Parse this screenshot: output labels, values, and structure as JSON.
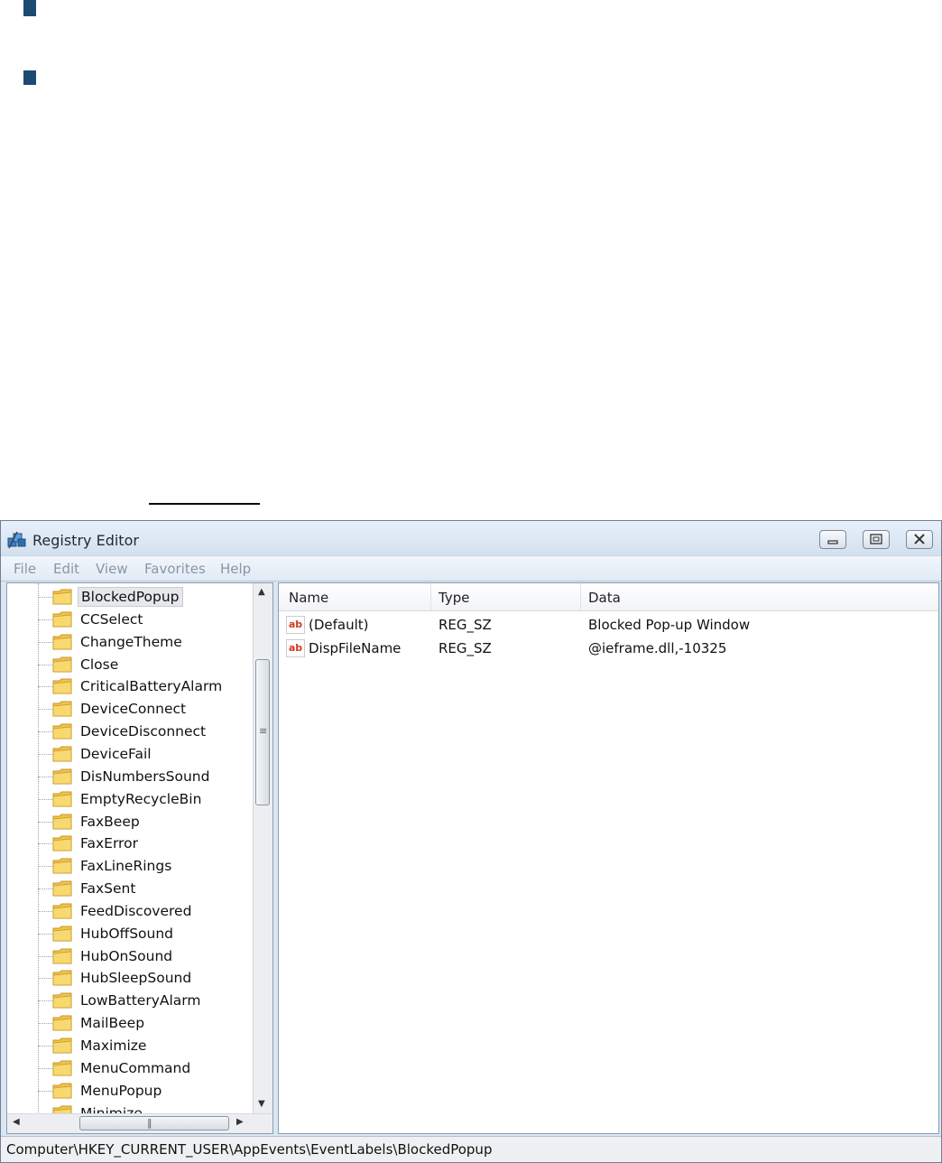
{
  "window": {
    "title": "Registry Editor",
    "icons": {
      "app": "registry-icon",
      "minimize": "minimize-icon",
      "restore": "restore-icon",
      "close": "close-icon"
    }
  },
  "menu": [
    "File",
    "Edit",
    "View",
    "Favorites",
    "Help"
  ],
  "tree": {
    "selected": "BlockedPopup",
    "items": [
      "BlockedPopup",
      "CCSelect",
      "ChangeTheme",
      "Close",
      "CriticalBatteryAlarm",
      "DeviceConnect",
      "DeviceDisconnect",
      "DeviceFail",
      "DisNumbersSound",
      "EmptyRecycleBin",
      "FaxBeep",
      "FaxError",
      "FaxLineRings",
      "FaxSent",
      "FeedDiscovered",
      "HubOffSound",
      "HubOnSound",
      "HubSleepSound",
      "LowBatteryAlarm",
      "MailBeep",
      "Maximize",
      "MenuCommand",
      "MenuPopup",
      "Minimize"
    ]
  },
  "list": {
    "columns": [
      "Name",
      "Type",
      "Data"
    ],
    "rows": [
      {
        "icon": "ab",
        "name": "(Default)",
        "type": "REG_SZ",
        "data": "Blocked Pop-up Window"
      },
      {
        "icon": "ab",
        "name": "DispFileName",
        "type": "REG_SZ",
        "data": "@ieframe.dll,-10325"
      }
    ]
  },
  "status": "Computer\\HKEY_CURRENT_USER\\AppEvents\\EventLabels\\BlockedPopup",
  "colors": {
    "bullet": "#1d4a72",
    "frame": "#dbe6f3",
    "ab_icon": "#d2381f",
    "folder": "#f0c44a"
  }
}
